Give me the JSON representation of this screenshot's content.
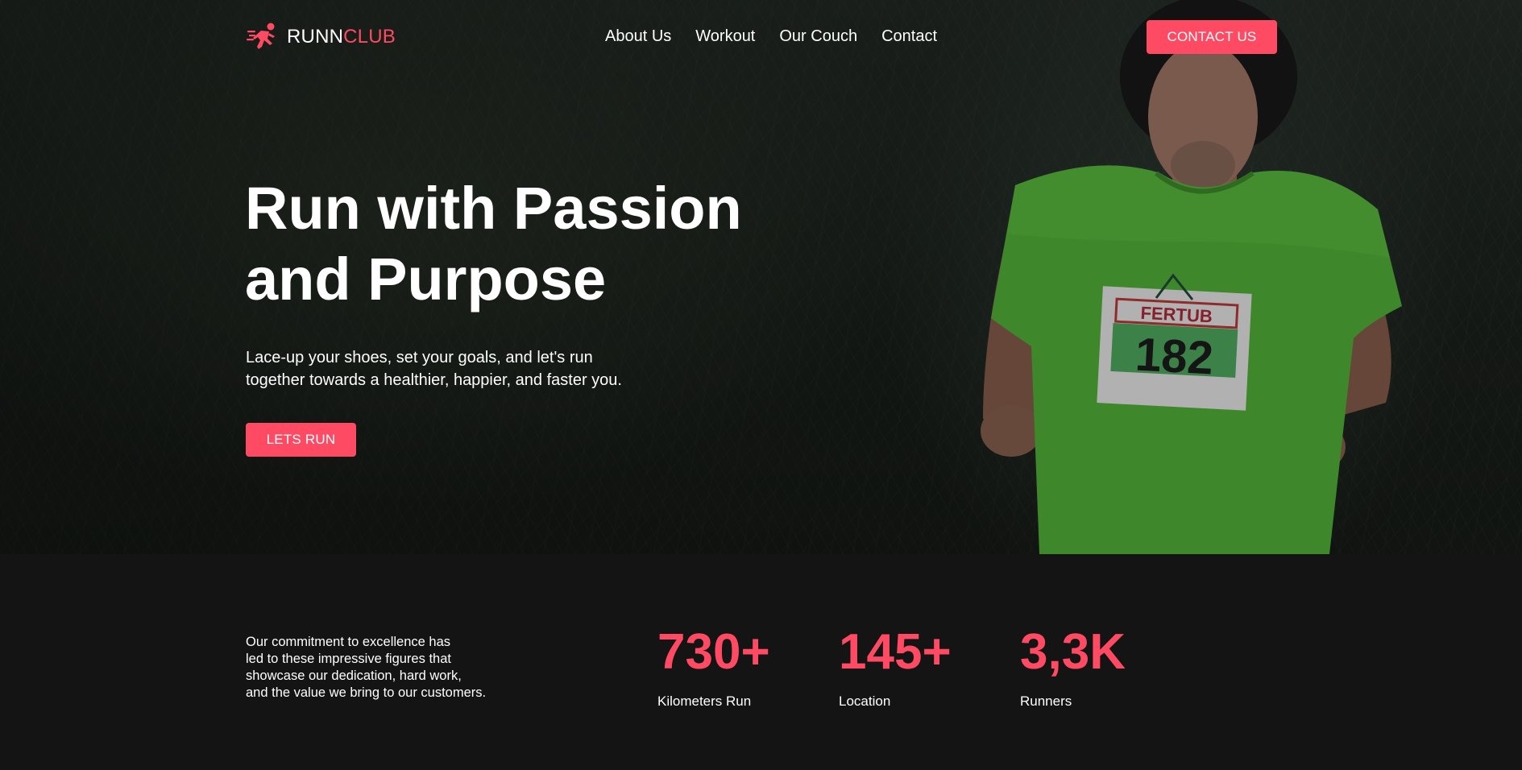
{
  "brand": {
    "name_part1": "RUNN",
    "name_part2": "CLUB",
    "icon": "running-person-icon",
    "accent_color": "#ff4a63"
  },
  "nav": {
    "items": [
      {
        "label": "About Us"
      },
      {
        "label": "Workout"
      },
      {
        "label": "Our Couch"
      },
      {
        "label": "Contact"
      }
    ],
    "cta_label": "CONTACT US"
  },
  "hero": {
    "title_line1": "Run with Passion",
    "title_line2": "and Purpose",
    "subtitle_line1": "Lace-up your shoes, set your goals, and let's run",
    "subtitle_line2": "together towards a healthier, happier, and faster you.",
    "cta_label": "LETS RUN",
    "bib_brand": "FERTUB",
    "bib_number": "182"
  },
  "stats": {
    "description_lines": [
      "Our commitment to excellence has",
      "led to these impressive figures that",
      "showcase our dedication, hard work,",
      "and the value we bring to our customers."
    ],
    "items": [
      {
        "value": "730+",
        "label": "Kilometers Run"
      },
      {
        "value": "145+",
        "label": "Location"
      },
      {
        "value": "3,3K",
        "label": "Runners"
      }
    ]
  }
}
